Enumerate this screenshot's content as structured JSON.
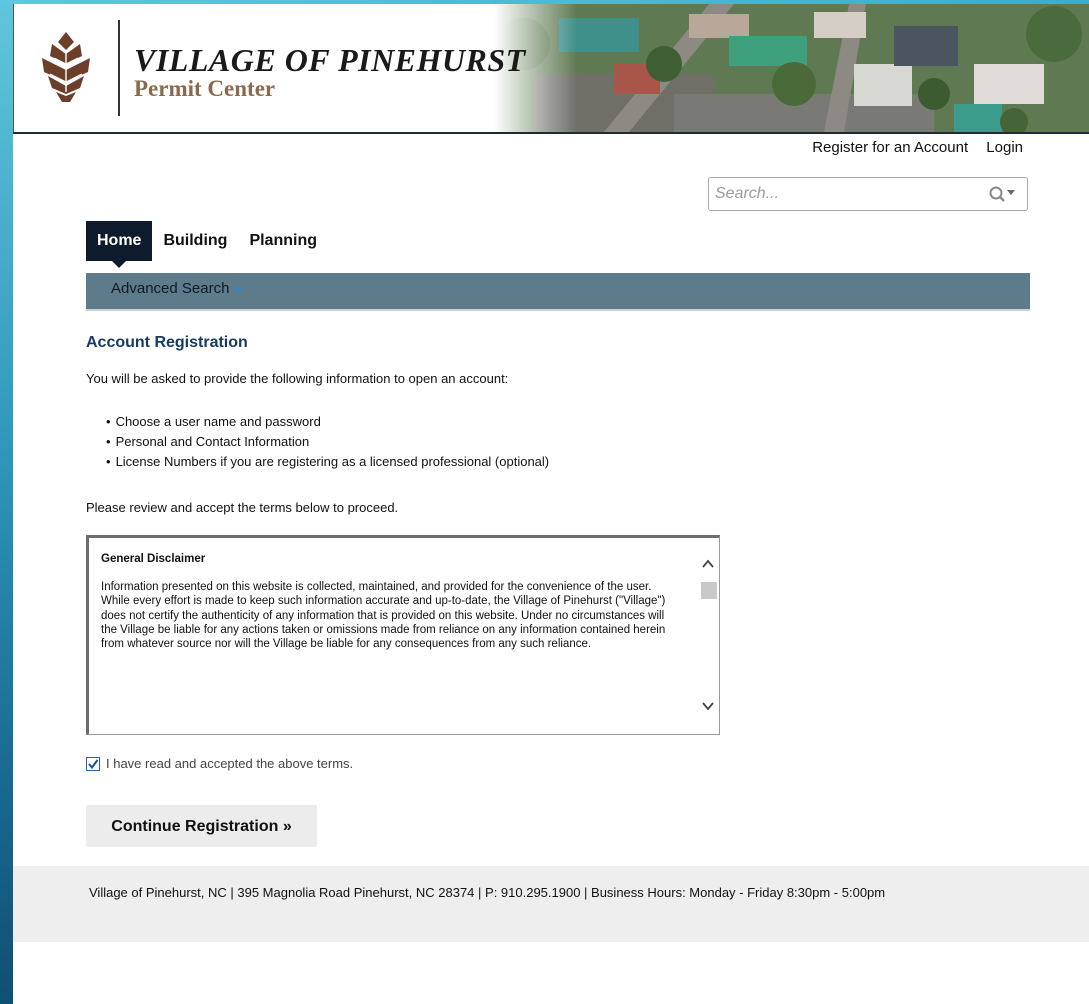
{
  "header": {
    "title": "VILLAGE OF PINEHURST",
    "subtitle": "Permit Center"
  },
  "account_links": {
    "register": "Register for an Account",
    "login": "Login"
  },
  "search": {
    "placeholder": "Search..."
  },
  "nav": {
    "tabs": [
      {
        "label": "Home",
        "active": true
      },
      {
        "label": "Building",
        "active": false
      },
      {
        "label": "Planning",
        "active": false
      }
    ]
  },
  "subnav": {
    "advanced_search": "Advanced Search"
  },
  "main": {
    "title": "Account Registration",
    "intro": "You will be asked to provide the following information to open an account:",
    "bullets": [
      "Choose a user name and password",
      "Personal and Contact Information",
      "License Numbers if you are registering as a licensed professional (optional)"
    ],
    "review_text": "Please review and accept the terms below to proceed."
  },
  "terms": {
    "heading": "General Disclaimer",
    "body": "Information presented on this website is collected, maintained, and provided for the convenience of the user.  While every effort is made to keep such information accurate and up-to-date, the Village of Pinehurst (\"Village\") does not certify the authenticity of any information that is provided on this website.  Under no circumstances will the Village be liable for any actions taken or omissions made from reliance on any information contained herein from whatever source nor will the Village be liable for any consequences from any such reliance."
  },
  "accept": {
    "label": "I have read and accepted the above terms.",
    "checked": true
  },
  "continue_button": "Continue Registration »",
  "footer": {
    "text": "Village of Pinehurst, NC | 395 Magnolia Road Pinehurst, NC 28374 | P: 910.295.1900 | Business Hours: Monday - Friday 8:30pm - 5:00pm"
  },
  "colors": {
    "nav_active_bg": "#0e1b2c",
    "subnav_bg": "#5e7b8c",
    "title_blue": "#173a66",
    "logo_brown": "#6b3f2a"
  },
  "icons": {
    "logo": "pinecone-icon",
    "search": "search-icon",
    "dropdown": "chevron-down-icon"
  }
}
